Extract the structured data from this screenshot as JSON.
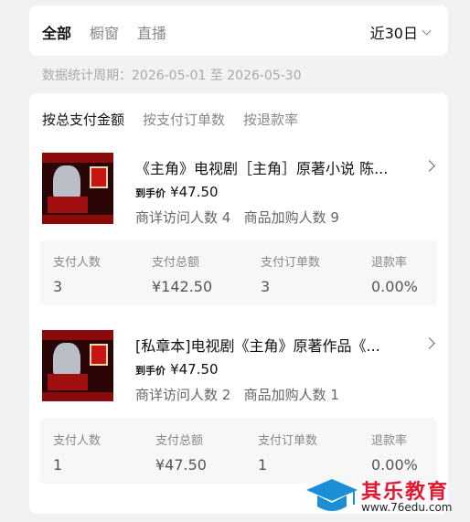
{
  "top_tabs": [
    "全部",
    "橱窗",
    "直播"
  ],
  "date_range": "近30日",
  "period": "数据统计周期：2026-05-01 至 2026-05-30",
  "sort_tabs": [
    "按总支付金额",
    "按支付订单数",
    "按退款率"
  ],
  "products": [
    {
      "title": "《主角》电视剧［主角］原著小说 陈...",
      "price_label": "到手价",
      "price": "¥47.50",
      "visits": "商详访问人数 4",
      "add_cart": "商品加购人数 9",
      "stats": [
        {
          "label": "支付人数",
          "value": "3"
        },
        {
          "label": "支付总额",
          "value": "¥142.50"
        },
        {
          "label": "支付订单数",
          "value": "3"
        },
        {
          "label": "退款率",
          "value": "0.00%"
        }
      ]
    },
    {
      "title": "[私章本]电视剧《主角》原著作品《...",
      "price_label": "到手价",
      "price": "¥47.50",
      "visits": "商详访问人数 2",
      "add_cart": "商品加购人数 1",
      "stats": [
        {
          "label": "支付人数",
          "value": "1"
        },
        {
          "label": "支付总额",
          "value": "¥47.50"
        },
        {
          "label": "支付订单数",
          "value": "1"
        },
        {
          "label": "退款率",
          "value": "0.00%"
        }
      ]
    }
  ],
  "watermark": {
    "name": "其乐教育",
    "url": "www.76edu.com"
  },
  "colors": {
    "accent_red": "#e01830",
    "logo_blue": "#1a8fd6"
  }
}
